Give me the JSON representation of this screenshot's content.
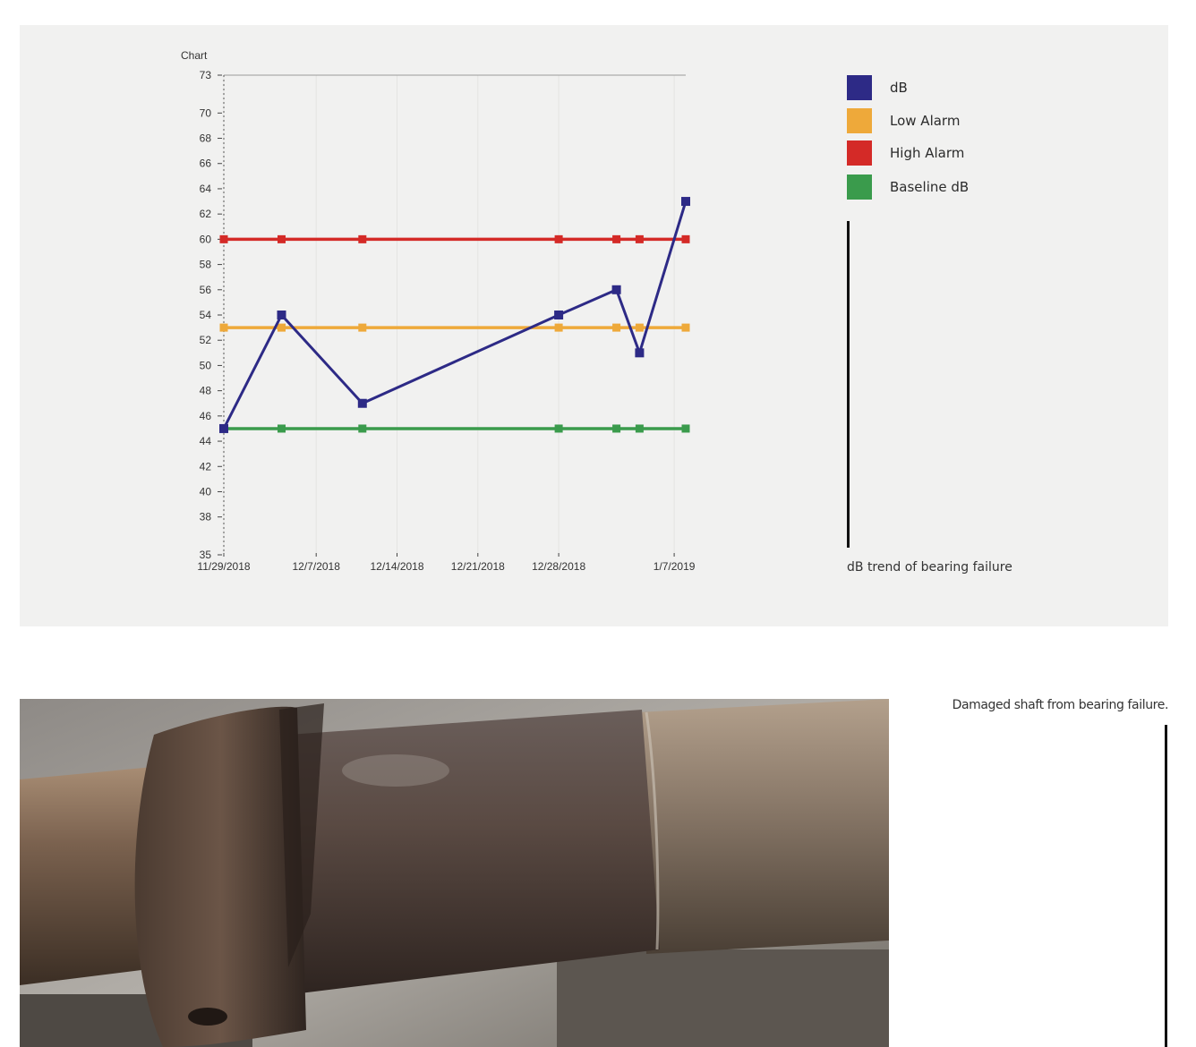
{
  "chart_data": {
    "type": "line",
    "title": "Chart",
    "xlabel": "",
    "ylabel": "",
    "ylim": [
      35,
      73
    ],
    "y_ticks": [
      35,
      38,
      40,
      42,
      44,
      46,
      48,
      50,
      52,
      54,
      56,
      58,
      60,
      62,
      64,
      66,
      68,
      70,
      73
    ],
    "x_tick_labels": [
      "11/29/2018",
      "12/7/2018",
      "12/14/2018",
      "12/21/2018",
      "12/28/2018",
      "1/7/2019"
    ],
    "x_dates": [
      "2018-11-29",
      "2018-12-04",
      "2018-12-11",
      "2018-12-28",
      "2019-01-02",
      "2019-01-04",
      "2019-01-08"
    ],
    "grid": true,
    "legend_position": "right",
    "series": [
      {
        "name": "dB",
        "color": "#2d2a86",
        "values": [
          45,
          54,
          47,
          54,
          56,
          51,
          63
        ]
      },
      {
        "name": "Low Alarm",
        "color": "#eea93a",
        "values": [
          53,
          53,
          53,
          53,
          53,
          53,
          53
        ]
      },
      {
        "name": "High Alarm",
        "color": "#d42a27",
        "values": [
          60,
          60,
          60,
          60,
          60,
          60,
          60
        ]
      },
      {
        "name": "Baseline dB",
        "color": "#3a9b4c",
        "values": [
          45,
          45,
          45,
          45,
          45,
          45,
          45
        ]
      }
    ]
  },
  "captions": {
    "chart": "dB trend of bearing failure",
    "photo": "Damaged shaft from bearing failure."
  },
  "photo": {
    "icon": "damaged-shaft-photo"
  }
}
